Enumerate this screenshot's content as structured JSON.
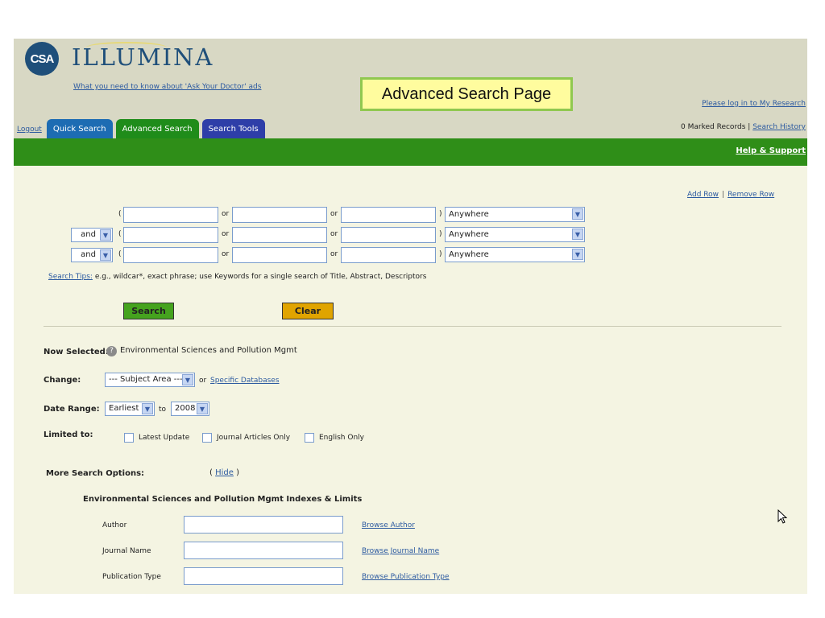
{
  "header": {
    "logo_badge": "CSA",
    "logo_word": "ILLUMINA",
    "tagline_link": "What you need to know about 'Ask Your Doctor' ads",
    "callout": "Advanced Search Page",
    "login_link": "Please log in to My Research",
    "marked_records": "0 Marked Records",
    "separator": "|",
    "search_history_link": "Search History",
    "help_link": "Help & Support"
  },
  "tabs": {
    "logout": "Logout",
    "quick": "Quick Search",
    "advanced": "Advanced Search",
    "tools": "Search Tools"
  },
  "query": {
    "add_row": "Add Row",
    "separator": "|",
    "remove_row": "Remove Row",
    "open_paren": "(",
    "close_paren": ")",
    "or_word": "or",
    "rows": [
      {
        "bool": "",
        "field": "Anywhere"
      },
      {
        "bool": "and",
        "field": "Anywhere"
      },
      {
        "bool": "and",
        "field": "Anywhere"
      }
    ],
    "tips_link": "Search Tips:",
    "tips_text": "e.g., wildcar*, exact phrase; use Keywords for a single search of Title, Abstract, Descriptors",
    "search_button": "Search",
    "clear_button": "Clear"
  },
  "selection": {
    "now_selected_label": "Now Selected:",
    "now_selected_value": "Environmental Sciences and Pollution Mgmt",
    "change_label": "Change:",
    "subject_area": "--- Subject Area ---",
    "or_word": "or",
    "specific_db_link": "Specific Databases",
    "date_range_label": "Date Range:",
    "date_from": "Earliest",
    "to_word": "to",
    "date_to": "2008",
    "limited_label": "Limited to:",
    "limits": [
      "Latest Update",
      "Journal Articles Only",
      "English Only"
    ]
  },
  "more_options": {
    "label": "More Search Options:",
    "hide_prefix": "(",
    "hide_link": "Hide",
    "hide_suffix": ")",
    "indexes_title": "Environmental Sciences and Pollution Mgmt Indexes & Limits",
    "indexes": [
      {
        "label": "Author",
        "link": "Browse Author"
      },
      {
        "label": "Journal Name",
        "link": "Browse Journal Name"
      },
      {
        "label": "Publication Type",
        "link": "Browse Publication Type"
      }
    ]
  }
}
